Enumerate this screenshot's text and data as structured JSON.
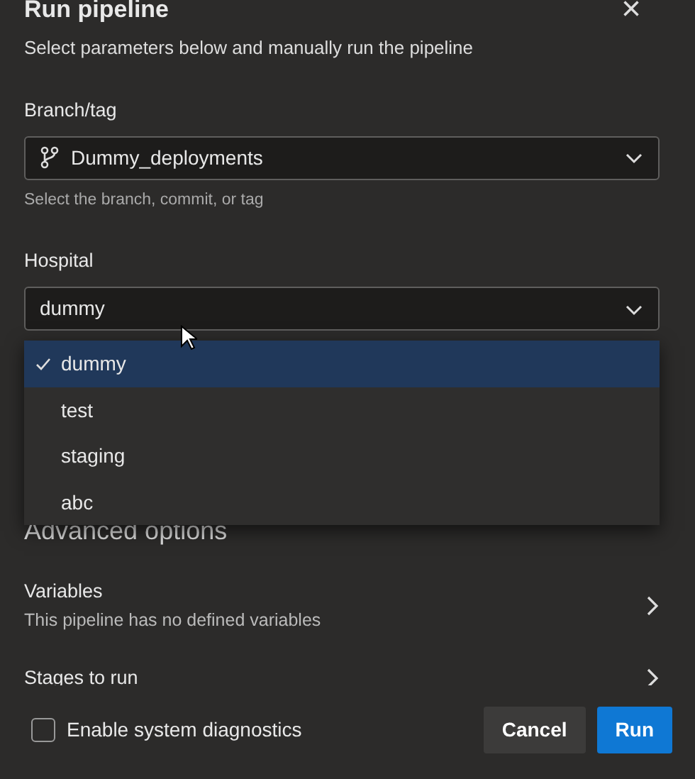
{
  "dialog": {
    "title": "Run pipeline",
    "subtitle": "Select parameters below and manually run the pipeline",
    "close": "×"
  },
  "branch": {
    "label": "Branch/tag",
    "value": "Dummy_deployments",
    "help": "Select the branch, commit, or tag"
  },
  "hospital": {
    "label": "Hospital",
    "value": "dummy",
    "expanded": true,
    "options": [
      {
        "label": "dummy",
        "selected": true
      },
      {
        "label": "test",
        "selected": false
      },
      {
        "label": "staging",
        "selected": false
      },
      {
        "label": "abc",
        "selected": false
      }
    ]
  },
  "advanced": {
    "heading": "Advanced options",
    "rows": [
      {
        "title": "Variables",
        "description": "This pipeline has no defined variables"
      },
      {
        "title": "Stages to run"
      }
    ]
  },
  "footer": {
    "diagnostics": {
      "label": "Enable system diagnostics",
      "checked": false
    },
    "buttons": [
      {
        "label": "Cancel",
        "kind": "secondary"
      },
      {
        "label": "Run",
        "kind": "primary"
      }
    ]
  }
}
